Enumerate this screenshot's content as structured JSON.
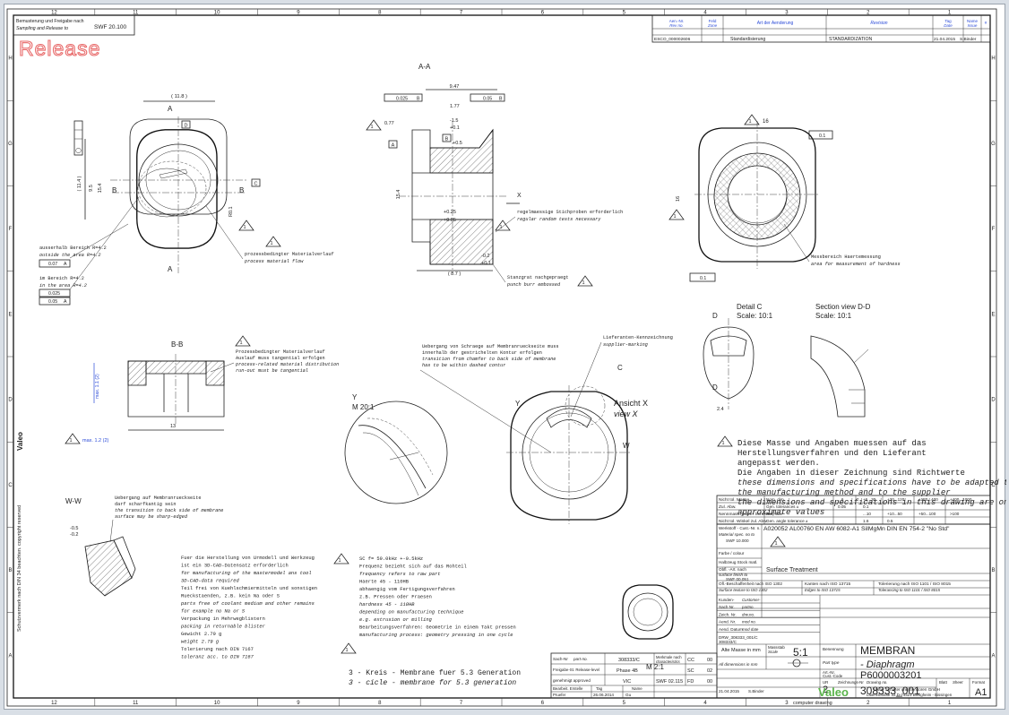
{
  "top_left": {
    "line1": "Bemusterung und Freigabe nach",
    "line2": "Sampling and Release to",
    "swf": "SWF 20.100",
    "release": "Release"
  },
  "zones_cols": [
    "12",
    "11",
    "10",
    "9",
    "8",
    "7",
    "6",
    "5",
    "4",
    "3",
    "2",
    "1"
  ],
  "zones_rows": [
    "H",
    "G",
    "F",
    "E",
    "D",
    "C",
    "B",
    "A"
  ],
  "revision": {
    "headers": [
      "Aen.-Nr.",
      "Feld",
      "Art der Aenderung",
      "Revision",
      "Tag",
      "Name",
      "Zone",
      "Rev no.",
      "Date",
      "Issue",
      "#"
    ],
    "row": [
      "ESCO_000002606",
      "",
      "Standardisierung",
      "STANDARDIZATION",
      "21.04.2015",
      "S.Binder"
    ]
  },
  "views": {
    "aa": "A-A",
    "bb": "B-B",
    "ww": "W-W",
    "y_label": "Y",
    "y_scale": "M  20:1",
    "detail_c": "Detail C",
    "detail_c_scale": "Scale:  10:1",
    "section_dd": "Section view D-D",
    "section_dd_scale": "Scale:  10:1",
    "ansicht_x": "Ansicht X",
    "view_x": "view X",
    "m21": "M 2:1",
    "c_label": "C",
    "d_label": "D",
    "w_label": "W",
    "x_label": "X",
    "y_small": "Y"
  },
  "dims": {
    "d11_8": "( 11.8 )",
    "d9_47": "9.47",
    "d1_77": "1.77",
    "d0_77": "0.77",
    "d_1_5": "-1.5",
    "d_0_1": "+0.1",
    "d_0_5": "+0.5",
    "d0_25": "+0.25",
    "d0_05": "+0.05",
    "d_0_2": "-0.2",
    "d0_1": "+0.1",
    "d8_7": "( 8.7 )",
    "d16": "16",
    "d13": "13",
    "d15_4": "15.4",
    "d11_4": "( 11.4 )",
    "d9_5": "9.5",
    "d2_4": "2.4",
    "d_05": "-0.5",
    "d_02": "-0.2",
    "max112": "max. 1.2 (2)",
    "max11": "max. 1.1 (2)",
    "r0_1": "R0.1",
    "d0_025": "0.025",
    "d0_05b": "0.05",
    "d0_07": "0.07",
    "d0_1b": "0.1",
    "d0_025b": "0.025",
    "d0_05c": "0.05",
    "d0_1c": "0.1",
    "a_l": "A",
    "b_l": "B",
    "c_l": "C",
    "d_l": "D"
  },
  "notes_aa": {
    "n1": "regelmaessige Stichproben erforderlich",
    "n2": "regular random tests necessary",
    "n3": "Stanzgrat nachgepraegt",
    "n4": "punch burr embossed"
  },
  "notes_left": {
    "n1": "ausserhalb Bereich R=4.2",
    "n2": "outside the area R=4.2",
    "n3": "im Bereich R=4.2",
    "n4": "in the area R=4.2",
    "n5": "prozessbedingter Materialverlauf",
    "n6": "process material flow"
  },
  "notes_hardness": {
    "n1": "Messbereich Haertemessung",
    "n2": "area for measurement of hardness"
  },
  "notes_bb": {
    "n1": "Prozessbedingter Materialverlauf",
    "n2": "Auslauf muss tangential erfolgen",
    "n3": "process-related material distribution",
    "n4": "run-out must be tangential"
  },
  "notes_transition": {
    "n1": "Uebergang von Schraege auf Membranrueckseite muss",
    "n2": "innerhalb der gestrichelten Kontur erfolgen",
    "n3": "transition from chamfer to back side of membrane",
    "n4": "has to be within dashed contur",
    "n5": "Lieferanten-Kennzeichnung",
    "n6": "supplier-marking"
  },
  "notes_ww": {
    "n1": "Uebergang auf Membranrueckseite",
    "n2": "darf scharfkantig sein",
    "n3": "the transition to back side of membrane",
    "n4": "surface may be sharp-edged"
  },
  "notes_general": [
    "Diese Masse und Angaben muessen auf das",
    "Herstellungsverfahren und den Lieferant",
    "angepasst werden.",
    "Die Angaben in dieser Zeichnung sind Richtwerte"
  ],
  "notes_general_en": [
    "these dimensions and specifications have to be adapted to",
    "the manufacturing method and to the supplier",
    "the dimensions and specifications in this drawing are only",
    "approximate values"
  ],
  "notes_bottom_left": [
    "Fuer die Herstellung von Urmodell und Werkzeug",
    "ist ein 3D-CAD-Datensatz erforderlich",
    "for manufacturing of the mastermodel ans tool",
    "3D-CAD-data required",
    "",
    "Teil frei von Kuehlschmiermitteln und sonstigen",
    "Rueckstaenden, z.B. kein Na oder S",
    "parts free of coolant medium and other remains",
    "for example no Na or S",
    "",
    "Verpackung in Mehrwegblistern",
    "packing in returnable blister",
    "",
    "Gewicht 2.79 g",
    "weight  2.79 g",
    "",
    "Tolerierung nach DIN 7167",
    "toleranz acc. to DIN 7167"
  ],
  "notes_bottom_mid": [
    "SC  f= 59.0kHz +-0.5kHz",
    "",
    "Frequenz bezieht sich auf das Rohteil",
    "frequency refers to raw part",
    "",
    "Haerte 45 - 110HB",
    "abhaengig vom Fertigungsverfahren",
    "z.B. Pressen oder Fraesen",
    "hardness 45 - 110HB",
    "depending on manufacturing technique",
    "e.g. extrusion or milling",
    "",
    "Bearbeitungsverfahren: Geometrie in einem Takt pressen",
    "manufacturing process: geometry pressing in one cycle"
  ],
  "kreis_1": "3 - Kreis - Membrane fuer 5.3 Generation",
  "kreis_2": "3 - cicle  - membrane for 5.3 generation",
  "tol_table": {
    "rows": [
      [
        "Nicht tol. Masse",
        "Nom. dim.",
        "...6",
        "+6...30",
        "+30...120",
        "+120...400",
        "+400...1000"
      ],
      [
        "Zul. Abw.",
        "Gen. tolerances ±",
        "0.05",
        "0.1",
        "",
        "",
        ""
      ],
      [
        "Nennmass (kurzer Schenkel)",
        "Ref. side",
        "",
        "...10",
        "+10...50",
        "+50...100",
        ">100"
      ],
      [
        "Nicht tol. Winkel zul. Abw.",
        "Gen. angle tolerance ±",
        "",
        "1.6",
        "0.5",
        "",
        ""
      ]
    ]
  },
  "title_block": {
    "werkstoff_l": "Werkstoff - Cust.-Nr. n.",
    "werkstoff_v": "A020052 AL00760 EN AW 6082-A1 SiIMgMn DIN EN 754-2  \"No Std\"",
    "mat_spec": "Material spec. no to",
    "mat_spec_v": "SWF 10.000",
    "farbe": "Farbe / colour",
    "halbzeug": "Halbzeug  Stock matl.",
    "oberfl_l": "Obfl. -Art. nach",
    "oberfl_l2": "surface finish to",
    "oberfl_l3": "SWF 00.051",
    "oberfl_v": "Surface Treatment",
    "ofl_besch": "Ofl.-Beschaffenheit nach ISO 1302",
    "ofl_besch_en": "Surface texture to ISO 1302",
    "kanten": "Kanten nach ISO 13715",
    "kanten_en": "Edges to ISO 13715",
    "toler": "Tolerierung nach ISO 1101 / ISO 8015",
    "toler_en": "Tolerancing to ISO 1101 / ISO 8015",
    "kunden": "Kunden-",
    "customer": "Customer-",
    "sach": "Sach Nr.",
    "partno": "partno.",
    "zeich": "Zeich. Nr.",
    "drwno": "drw.no.",
    "aend": "Aend. Nr.",
    "modno": "mod no.",
    "aend_datum": "Aend. Datum",
    "mod_date": "mod date",
    "dwg_ref": "DRW_308333_001/C",
    "dwg_ref2": "308333/C",
    "alte_masse": "Alte Masse in mm",
    "massstab": "Massstab",
    "scale": "Scale",
    "scale_v": "5:1",
    "all_dims": "All dimensions in mm",
    "benennung": "Benennung",
    "title_de": "MEMBRAN",
    "part_type": "Part type",
    "title_en": "- Diaphragm",
    "art_nr": "Art.-Nr.",
    "cust_code": "Cust.-Code",
    "part_number": "P6000003201",
    "ur": "UR",
    "ur_v": "2",
    "zeich_nr": "Zeichnungs-Nr",
    "drawing_no": "Drawing no.",
    "drawing_v": "308333_001",
    "blatt": "Blatt",
    "sheet": "Sheet",
    "format": "Format",
    "format_v": "A1",
    "sach_nr_l": "Sach-Nr",
    "part_no_l": "part-no.",
    "sach_v": "308333/C",
    "merkmale": "Merkmale nach",
    "characteristics": "characteristics",
    "freigabe": "Freigabe-St. Release-level",
    "phase": "Phase 4B",
    "genehmigt": "genehmigt  approved",
    "vic": "VIC",
    "swf_v": "SWF 02.115",
    "cc": "CC",
    "cc_v": "00",
    "sc": "SC",
    "sc_v": "02",
    "fd": "FD",
    "fd_v": "00",
    "bearb": "Bearbeit. Erstelle",
    "tag": "Tag",
    "datum": "Datum",
    "name": "Name",
    "bearb_date": "26.06.2014",
    "bearb_name": "Gu",
    "pruefer": "Pruefer",
    "pruef_date": "21.04.2015",
    "pruef_name": "S.Binder",
    "company": "Valeo Schalter und Sensoren GmbH",
    "address": "Laiernstrasse 12    D-74321 Bietigheim - Bissingen",
    "logo": "Valeo",
    "footer": "computer drawing"
  },
  "side_text": {
    "copyright": "Schutzvermerk nach DIN 34 beachten. copyright reserved",
    "logo": "Valeo"
  }
}
